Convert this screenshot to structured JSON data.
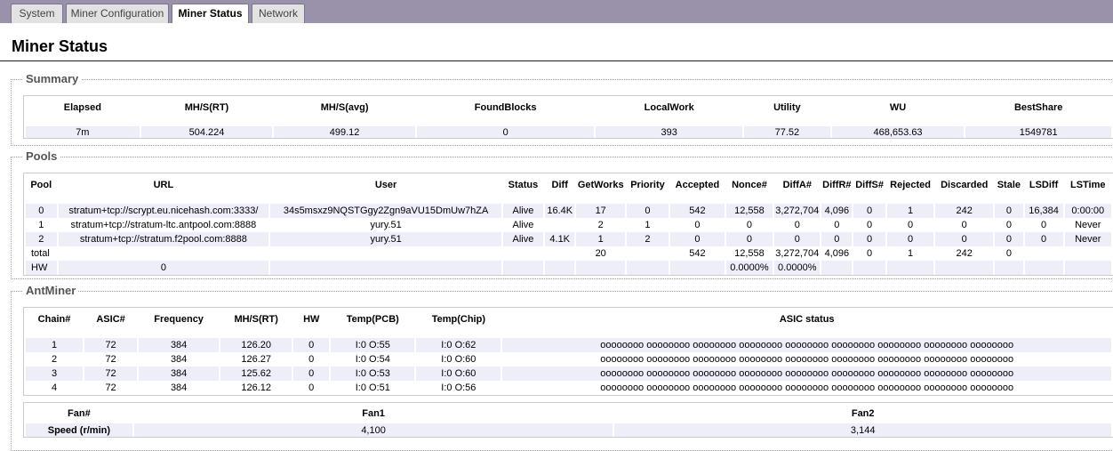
{
  "tabs": [
    {
      "label": "System"
    },
    {
      "label": "Miner Configuration"
    },
    {
      "label": "Miner Status"
    },
    {
      "label": "Network"
    }
  ],
  "page_title": "Miner Status",
  "summary": {
    "legend": "Summary",
    "headers": [
      "Elapsed",
      "MH/S(RT)",
      "MH/S(avg)",
      "FoundBlocks",
      "LocalWork",
      "Utility",
      "WU",
      "BestShare"
    ],
    "row": [
      "7m",
      "504.224",
      "499.12",
      "0",
      "393",
      "77.52",
      "468,653.63",
      "1549781"
    ]
  },
  "pools": {
    "legend": "Pools",
    "headers": [
      "Pool",
      "URL",
      "User",
      "Status",
      "Diff",
      "GetWorks",
      "Priority",
      "Accepted",
      "Nonce#",
      "DiffA#",
      "DiffR#",
      "DiffS#",
      "Rejected",
      "Discarded",
      "Stale",
      "LSDiff",
      "LSTime"
    ],
    "rows": [
      [
        "0",
        "stratum+tcp://scrypt.eu.nicehash.com:3333/",
        "34s5msxz9NQSTGgy2Zgn9aVU15DmUw7hZA",
        "Alive",
        "16.4K",
        "17",
        "0",
        "542",
        "12,558",
        "3,272,704",
        "4,096",
        "0",
        "1",
        "242",
        "0",
        "16,384",
        "0:00:00"
      ],
      [
        "1",
        "stratum+tcp://stratum-ltc.antpool.com:8888",
        "yury.51",
        "Alive",
        "",
        "2",
        "1",
        "0",
        "0",
        "0",
        "0",
        "0",
        "0",
        "0",
        "0",
        "0",
        "Never"
      ],
      [
        "2",
        "stratum+tcp://stratum.f2pool.com:8888",
        "yury.51",
        "Alive",
        "4.1K",
        "1",
        "2",
        "0",
        "0",
        "0",
        "0",
        "0",
        "0",
        "0",
        "0",
        "0",
        "Never"
      ],
      [
        "total",
        "",
        "",
        "",
        "",
        "20",
        "",
        "542",
        "12,558",
        "3,272,704",
        "4,096",
        "0",
        "1",
        "242",
        "0",
        "",
        ""
      ],
      [
        "HW",
        "0",
        "",
        "",
        "",
        "",
        "",
        "",
        "0.0000%",
        "0.0000%",
        "",
        "",
        "",
        "",
        "",
        "",
        ""
      ]
    ]
  },
  "antminer": {
    "legend": "AntMiner",
    "headers": [
      "Chain#",
      "ASIC#",
      "Frequency",
      "MH/S(RT)",
      "HW",
      "Temp(PCB)",
      "Temp(Chip)",
      "ASIC status"
    ],
    "rows": [
      [
        "1",
        "72",
        "384",
        "126.20",
        "0",
        "I:0 O:55",
        "I:0 O:62",
        "oooooooo oooooooo oooooooo oooooooo oooooooo oooooooo oooooooo oooooooo oooooooo"
      ],
      [
        "2",
        "72",
        "384",
        "126.27",
        "0",
        "I:0 O:54",
        "I:0 O:60",
        "oooooooo oooooooo oooooooo oooooooo oooooooo oooooooo oooooooo oooooooo oooooooo"
      ],
      [
        "3",
        "72",
        "384",
        "125.62",
        "0",
        "I:0 O:53",
        "I:0 O:60",
        "oooooooo oooooooo oooooooo oooooooo oooooooo oooooooo oooooooo oooooooo oooooooo"
      ],
      [
        "4",
        "72",
        "384",
        "126.12",
        "0",
        "I:0 O:51",
        "I:0 O:56",
        "oooooooo oooooooo oooooooo oooooooo oooooooo oooooooo oooooooo oooooooo oooooooo"
      ]
    ],
    "fan_headers": [
      "Fan#",
      "Fan1",
      "Fan2"
    ],
    "fan_row": [
      "Speed (r/min)",
      "4,100",
      "3,144"
    ]
  }
}
